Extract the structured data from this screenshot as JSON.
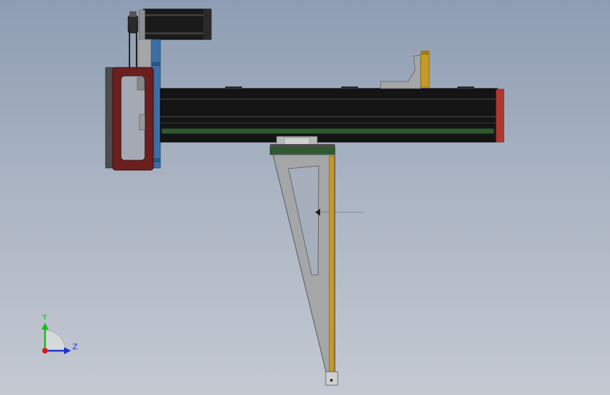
{
  "viewport": {
    "background_top": "#8e9db3",
    "background_bottom": "#c4c9d2"
  },
  "model": {
    "colors": {
      "rail_black": "#141414",
      "rail_highlight": "#3a3a3a",
      "green_strip": "#2f5a2f",
      "end_cap_red": "#b0392e",
      "frame_maroon": "#6b1f1f",
      "plate_blue": "#3b6fa6",
      "gray_part": "#a4a6a8",
      "gold_rod": "#c79a22",
      "motor_black": "#1a1a1a"
    }
  },
  "triad": {
    "y_label": "Y",
    "z_label": "Z",
    "y_color": "#1db81d",
    "z_color": "#1f35c8",
    "x_color": "#d11c1c"
  }
}
